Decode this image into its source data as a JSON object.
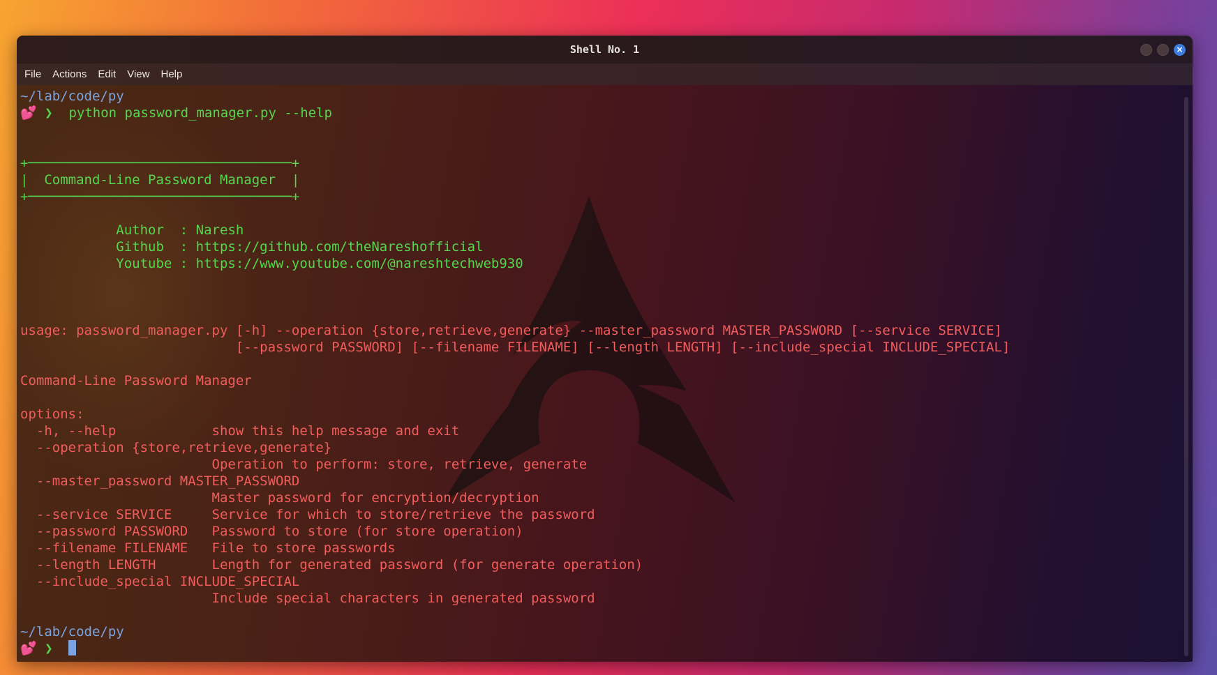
{
  "window": {
    "title": "Shell No. 1",
    "close_glyph": "×"
  },
  "menu": [
    "File",
    "Actions",
    "Edit",
    "View",
    "Help"
  ],
  "prompt": {
    "path": "~/lab/code/py",
    "icon": "💕",
    "arrow": "❯",
    "command": "python password_manager.py --help"
  },
  "banner": {
    "border": "+─────────────────────────────────+",
    "title_line": "|  Command-Line Password Manager  |"
  },
  "info": {
    "author_line": "            Author  : Naresh",
    "github_line": "            Github  : https://github.com/theNareshofficial",
    "youtube_line": "            Youtube : https://www.youtube.com/@nareshtechweb930"
  },
  "help": {
    "usage_1": "usage: password_manager.py [-h] --operation {store,retrieve,generate} --master_password MASTER_PASSWORD [--service SERVICE]",
    "usage_2": "                           [--password PASSWORD] [--filename FILENAME] [--length LENGTH] [--include_special INCLUDE_SPECIAL]",
    "description": "Command-Line Password Manager",
    "options_header": "options:",
    "options": [
      "  -h, --help            show this help message and exit",
      "  --operation {store,retrieve,generate}",
      "                        Operation to perform: store, retrieve, generate",
      "  --master_password MASTER_PASSWORD",
      "                        Master password for encryption/decryption",
      "  --service SERVICE     Service for which to store/retrieve the password",
      "  --password PASSWORD   Password to store (for store operation)",
      "  --filename FILENAME   File to store passwords",
      "  --length LENGTH       Length for generated password (for generate operation)",
      "  --include_special INCLUDE_SPECIAL",
      "                        Include special characters in generated password"
    ]
  },
  "prompt2": {
    "path": "~/lab/code/py",
    "icon": "💕",
    "arrow": "❯"
  },
  "colors": {
    "path": "#7aa3e0",
    "green": "#54d64f",
    "red": "#f25c5c",
    "close_button": "#3d7dde"
  }
}
